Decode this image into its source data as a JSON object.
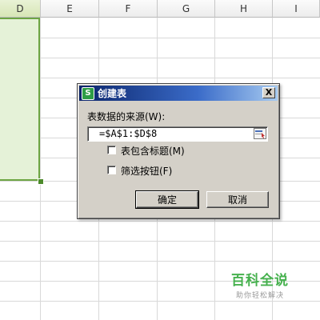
{
  "sheet": {
    "columns": [
      "D",
      "E",
      "F",
      "G",
      "H",
      "I"
    ]
  },
  "dialog": {
    "title": "创建表",
    "app_icon": "S",
    "close_label": "X",
    "source_label": "表数据的来源(W):",
    "source_value": "=$A$1:$D$8",
    "range_picker_icon": "range-select-icon",
    "options": [
      {
        "label": "表包含标题(M)",
        "checked": false
      },
      {
        "label": "筛选按钮(F)",
        "checked": false
      }
    ],
    "ok_label": "确定",
    "cancel_label": "取消"
  },
  "watermark": {
    "title": "百科全说",
    "subtitle": "助你轻松解决"
  },
  "colors": {
    "selection_fill": "#e5f2d8",
    "selection_border": "#6da543",
    "titlebar": "#0a246a",
    "dialog_bg": "#d4d0c8",
    "watermark": "#46b14e"
  }
}
